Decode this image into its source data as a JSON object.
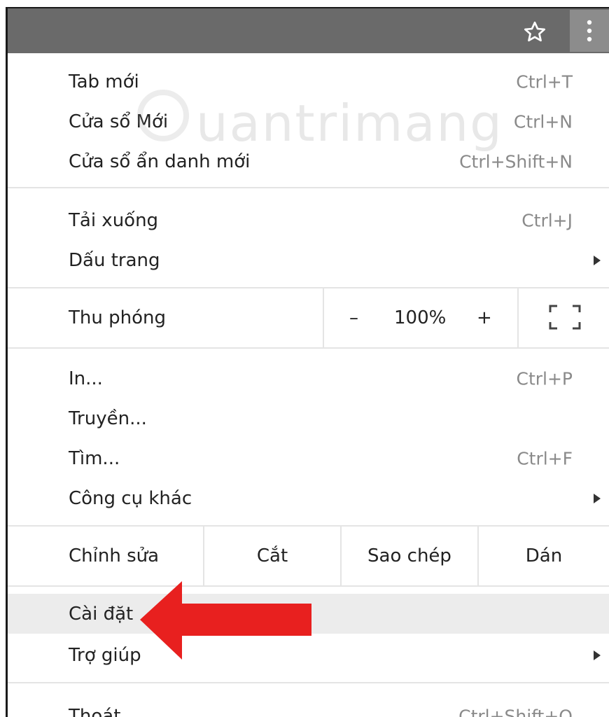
{
  "toolbar": {
    "star_icon": "star-icon",
    "menu_icon": "kebab-menu-icon"
  },
  "menu": {
    "new_tab": {
      "label": "Tab mới",
      "shortcut": "Ctrl+T"
    },
    "new_window": {
      "label": "Cửa sổ Mới",
      "shortcut": "Ctrl+N"
    },
    "incognito": {
      "label": "Cửa sổ ẩn danh mới",
      "shortcut": "Ctrl+Shift+N"
    },
    "downloads": {
      "label": "Tải xuống",
      "shortcut": "Ctrl+J"
    },
    "bookmarks": {
      "label": "Dấu trang"
    },
    "zoom": {
      "label": "Thu phóng",
      "minus": "–",
      "value": "100%",
      "plus": "+"
    },
    "print": {
      "label": "In...",
      "shortcut": "Ctrl+P"
    },
    "cast": {
      "label": "Truyền..."
    },
    "find": {
      "label": "Tìm...",
      "shortcut": "Ctrl+F"
    },
    "more_tools": {
      "label": "Công cụ khác"
    },
    "edit": {
      "label": "Chỉnh sửa",
      "cut": "Cắt",
      "copy": "Sao chép",
      "paste": "Dán"
    },
    "settings": {
      "label": "Cài đặt"
    },
    "help": {
      "label": "Trợ giúp"
    },
    "exit": {
      "label": "Thoát",
      "shortcut": "Ctrl+Shift+Q"
    }
  },
  "watermark": {
    "text": "uantrimang"
  },
  "colors": {
    "toolbar": "#6a6a6a",
    "highlight": "#ececec",
    "arrow": "#e8201f"
  }
}
